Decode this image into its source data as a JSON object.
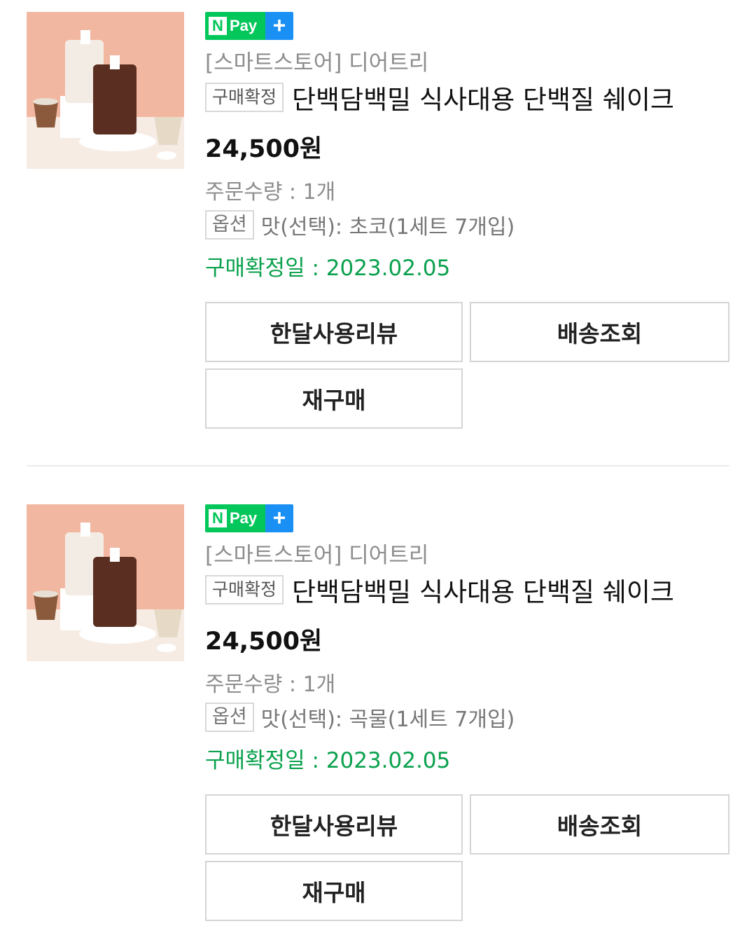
{
  "orders": [
    {
      "npay_label": "Pay",
      "npay_plus": "+",
      "npay_n": "N",
      "store": "[스마트스토어] 디어트리",
      "status_tag": "구매확정",
      "title": "단백담백밀 식사대용 단백질 쉐이크",
      "price": "24,500원",
      "quantity": "주문수량 : 1개",
      "option_tag": "옵션",
      "option_text": "맛(선택): 초코(1세트 7개입)",
      "confirm_date": "구매확정일 : 2023.02.05",
      "buttons": {
        "review": "한달사용리뷰",
        "shipping": "배송조회",
        "rebuy": "재구매"
      }
    },
    {
      "npay_label": "Pay",
      "npay_plus": "+",
      "npay_n": "N",
      "store": "[스마트스토어] 디어트리",
      "status_tag": "구매확정",
      "title": "단백담백밀 식사대용 단백질 쉐이크",
      "price": "24,500원",
      "quantity": "주문수량 : 1개",
      "option_tag": "옵션",
      "option_text": "맛(선택): 곡물(1세트 7개입)",
      "confirm_date": "구매확정일 : 2023.02.05",
      "buttons": {
        "review": "한달사용리뷰",
        "shipping": "배송조회",
        "rebuy": "재구매"
      }
    }
  ],
  "colors": {
    "npay_green": "#03c75a",
    "npay_blue": "#1a90f5",
    "confirm_green": "#0aa14d"
  },
  "icons": {
    "npay_badge": "npay-plus-badge-icon",
    "thumbnail": "product-thumbnail"
  }
}
